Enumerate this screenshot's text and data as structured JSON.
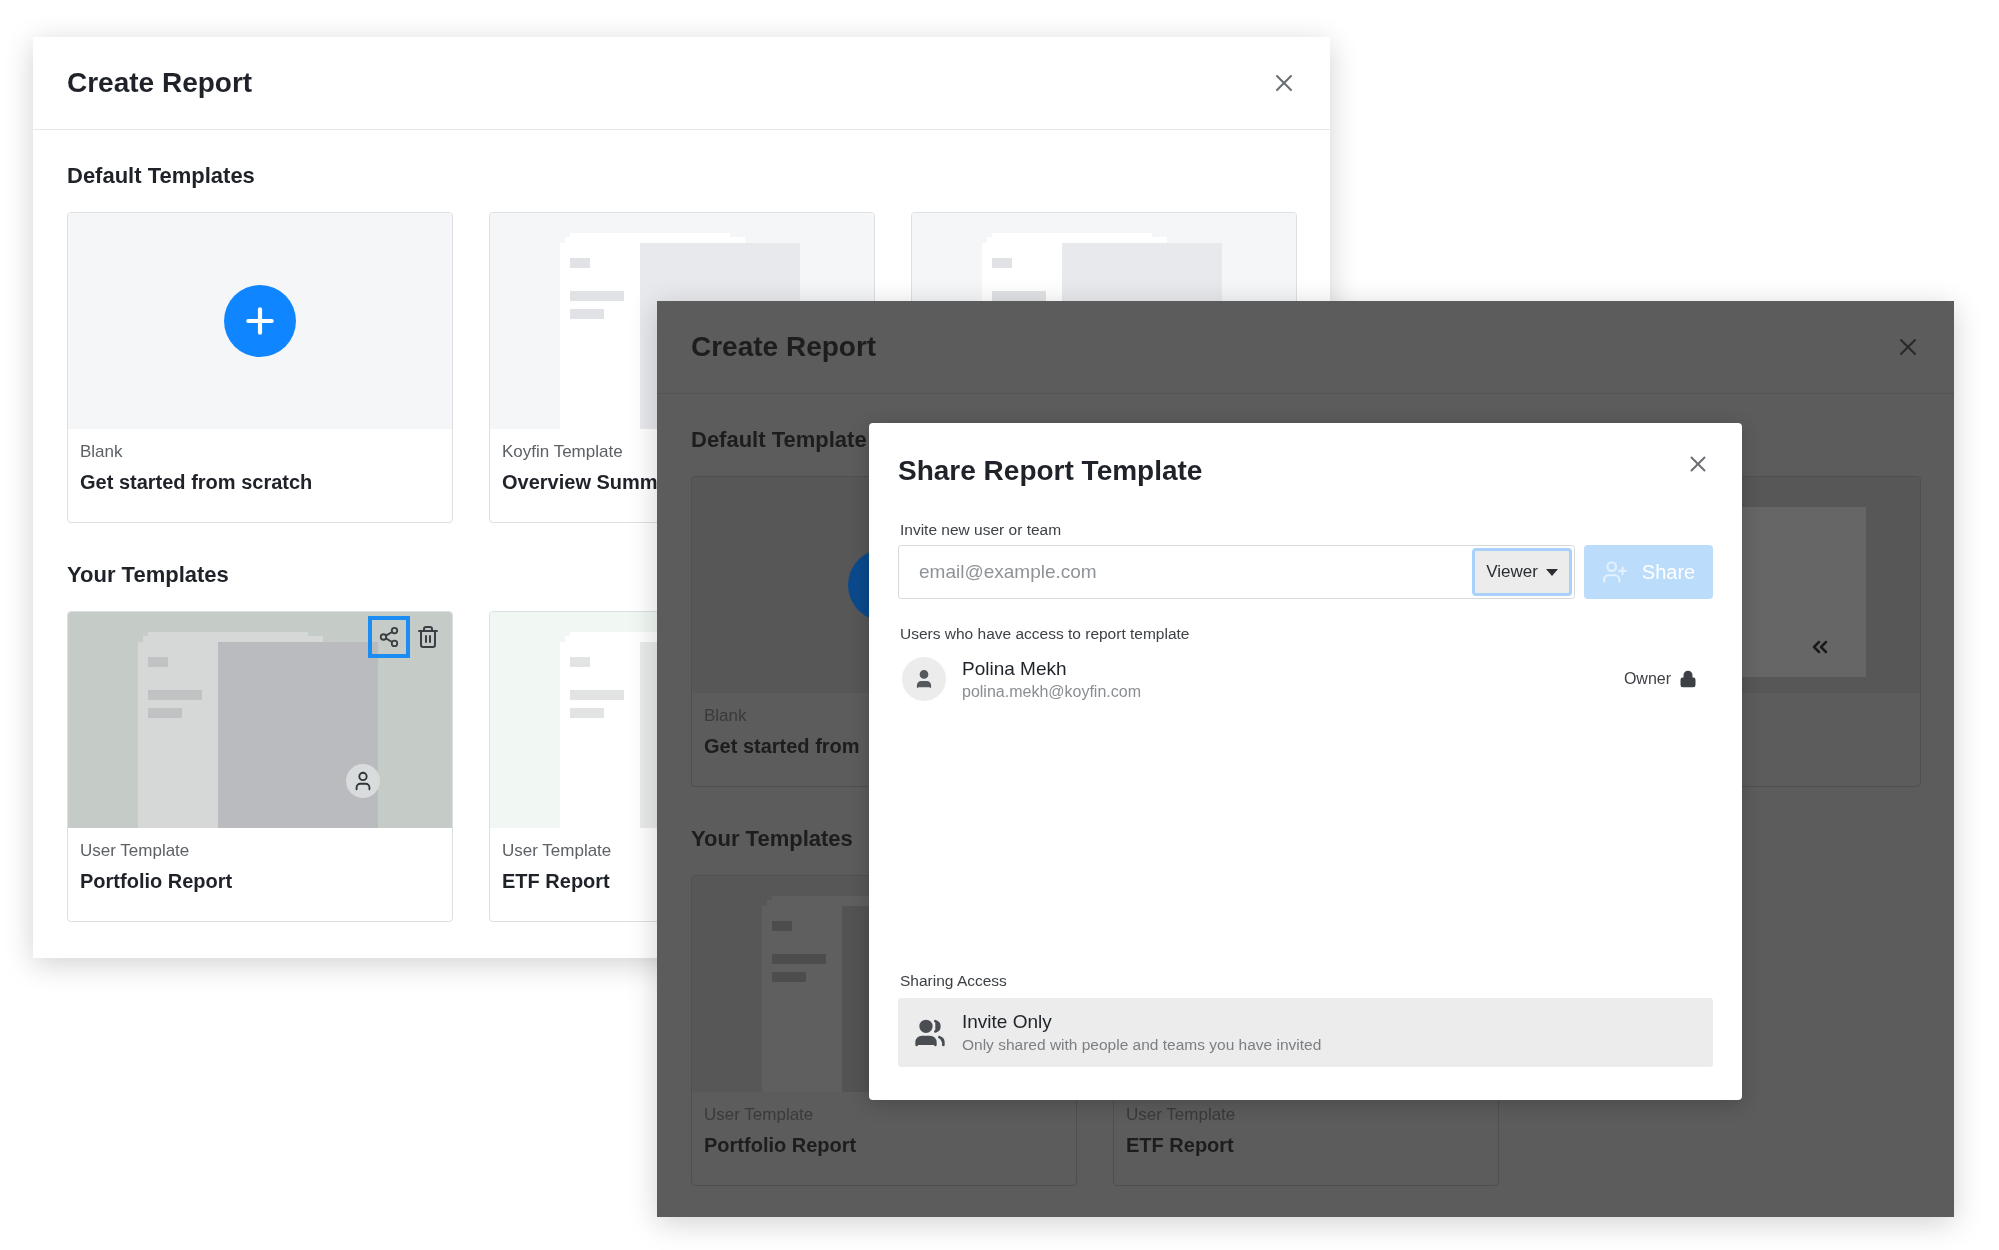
{
  "windows": [
    {
      "title": "Create Report",
      "dimmed": false,
      "sections": [
        {
          "heading": "Default Templates",
          "cards": [
            {
              "kind": "blank",
              "label": "Blank",
              "title": "Get started from scratch"
            },
            {
              "kind": "template",
              "label": "Koyfin Template",
              "title": "Overview Summ"
            },
            {
              "kind": "template"
            }
          ]
        },
        {
          "heading": "Your Templates",
          "cards": [
            {
              "kind": "template",
              "hovered": true,
              "label": "User Template",
              "title": "Portfolio Report"
            },
            {
              "kind": "fresh",
              "label": "User Template",
              "title": "ETF Report"
            }
          ]
        }
      ]
    },
    {
      "title": "Create Report",
      "dimmed": true,
      "sections": [
        {
          "heading": "Default Template",
          "cards": [
            {
              "kind": "blank",
              "label": "Blank",
              "title": "Get started from"
            },
            {
              "kind": "pinned"
            }
          ]
        },
        {
          "heading": "Your Templates",
          "cards": [
            {
              "kind": "template",
              "label": "User Template",
              "title": "Portfolio Report"
            },
            {
              "kind": "template",
              "label": "User Template",
              "title": "ETF Report"
            }
          ]
        }
      ]
    }
  ],
  "share_dialog": {
    "title": "Share Report Template",
    "invite_label": "Invite new user or team",
    "email_placeholder": "email@example.com",
    "role": "Viewer",
    "share_button": {
      "label": "Share",
      "disabled": true
    },
    "access_label": "Users who have access to report template",
    "users": [
      {
        "name": "Polina Mekh",
        "email": "polina.mekh@koyfin.com",
        "role": "Owner",
        "locked": true
      }
    ],
    "sharing_label": "Sharing Access",
    "sharing": {
      "title": "Invite Only",
      "description": "Only shared with people and teams you have invited"
    }
  }
}
